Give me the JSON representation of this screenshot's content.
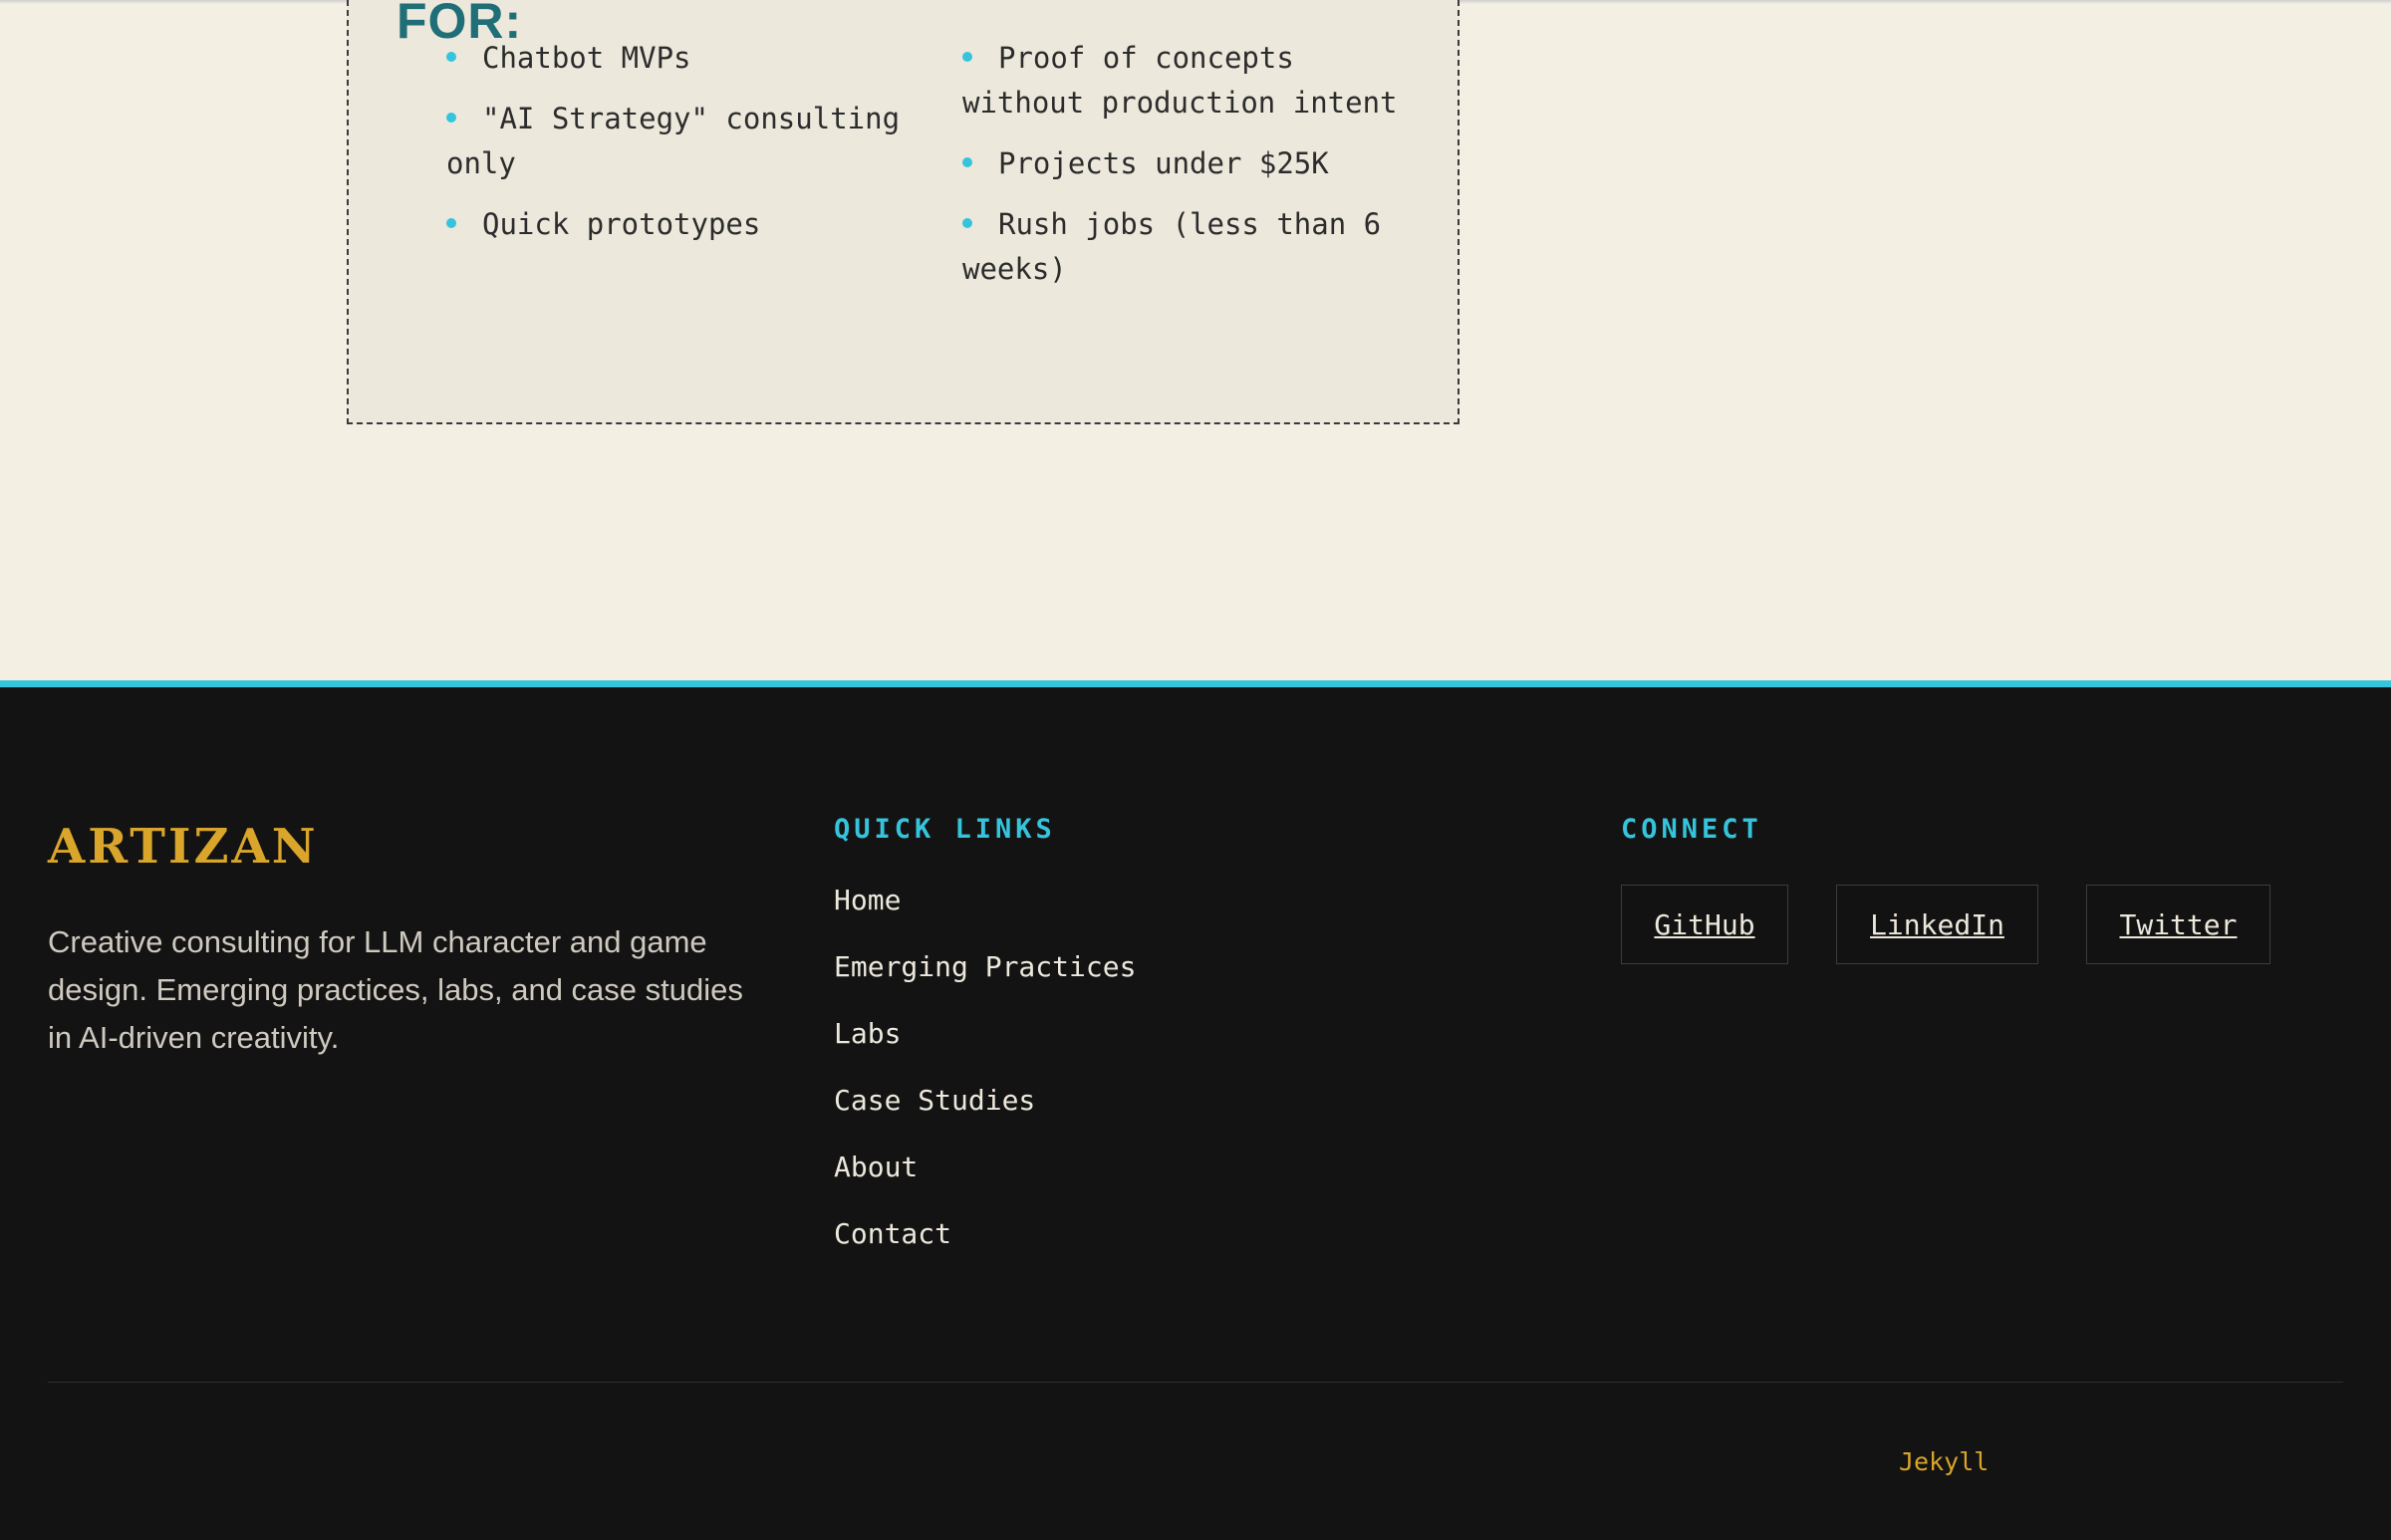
{
  "not_for": {
    "heading": "FOR:",
    "left_items": [
      "Chatbot MVPs",
      "\"AI Strategy\" consulting only",
      "Quick prototypes"
    ],
    "right_items": [
      "Proof of concepts without production intent",
      "Projects under $25K",
      "Rush jobs (less than 6 weeks)"
    ]
  },
  "footer": {
    "brand": "ARTIZAN",
    "description": "Creative consulting for LLM character and game design. Emerging practices, labs, and case studies in AI-driven creativity.",
    "quick_links": {
      "heading": "QUICK LINKS",
      "items": [
        "Home",
        "Emerging Practices",
        "Labs",
        "Case Studies",
        "About",
        "Contact"
      ]
    },
    "connect": {
      "heading": "CONNECT",
      "buttons": [
        "GitHub",
        "LinkedIn",
        "Twitter"
      ]
    },
    "credit_link": "Jekyll"
  },
  "colors": {
    "accent_cyan": "#35c4dc",
    "brand_gold": "#d9a52a",
    "heading_teal": "#1f6e78",
    "page_bg": "#f3efe3",
    "footer_bg": "#131313"
  }
}
